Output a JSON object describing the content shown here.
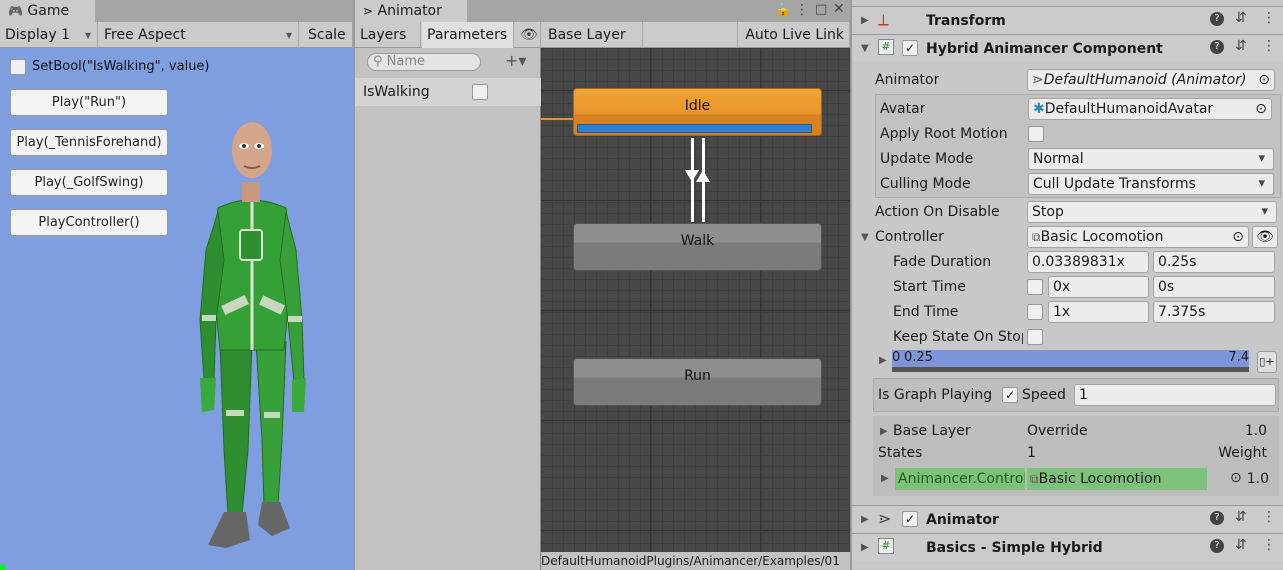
{
  "game": {
    "tab_title": "Game",
    "display": "Display 1",
    "aspect": "Free Aspect",
    "scale": "Scale",
    "toggle_label": "SetBool(\"IsWalking\", value)",
    "buttons": [
      "Play(\"Run\")",
      "Play(_TennisForehand)",
      "Play(_GolfSwing)",
      "PlayController()"
    ],
    "bg_color": "#7e9ee0"
  },
  "animator": {
    "tab_title": "Animator",
    "tabs": [
      "Layers",
      "Parameters"
    ],
    "breadcrumb": "Base Layer",
    "auto_live_link": "Auto Live Link",
    "search_placeholder": "Name",
    "parameters": [
      {
        "name": "IsWalking"
      }
    ],
    "states": [
      "Idle",
      "Walk",
      "Run"
    ],
    "status_path": "DefaultHumanoidPlugins/Animancer/Examples/01"
  },
  "inspector": {
    "transform_title": "Transform",
    "component_title": "Hybrid Animancer Component",
    "rows": {
      "animator_label": "Animator",
      "animator_value": "DefaultHumanoid (Animator)",
      "avatar_label": "Avatar",
      "avatar_value": "DefaultHumanoidAvatar",
      "apply_root_motion_label": "Apply Root Motion",
      "update_mode_label": "Update Mode",
      "update_mode_value": "Normal",
      "culling_mode_label": "Culling Mode",
      "culling_mode_value": "Cull Update Transforms",
      "action_on_disable_label": "Action On Disable",
      "action_on_disable_value": "Stop",
      "controller_label": "Controller",
      "controller_value": "Basic Locomotion",
      "fade_duration_label": "Fade Duration",
      "fade_duration_x": "0.03389831x",
      "fade_duration_s": "0.25s",
      "start_time_label": "Start Time",
      "start_time_x": "0x",
      "start_time_s": "0s",
      "end_time_label": "End Time",
      "end_time_x": "1x",
      "end_time_s": "7.375s",
      "keep_state_label": "Keep State On Stop",
      "timeline_start": "0",
      "timeline_fade": "0.25",
      "timeline_end": "7.4",
      "is_graph_playing_label": "Is Graph Playing",
      "speed_label": "Speed",
      "speed_value": "1",
      "base_layer_label": "Base Layer",
      "base_layer_mode": "Override",
      "base_layer_weight": "1.0",
      "states_label": "States",
      "states_count": "1",
      "weight_label": "Weight",
      "state_name": "Animancer.ControllerState",
      "state_controller": "Basic Locomotion",
      "state_weight": "1.0"
    },
    "animator_comp_title": "Animator",
    "basics_title": "Basics - Simple Hybrid"
  },
  "colors": {
    "idle_orange": "#e8942a",
    "progress_blue": "#2f80d1",
    "timeline_blue": "#7d95d8",
    "state_green": "#7cc27a",
    "body_green": "#3a9a3a"
  }
}
